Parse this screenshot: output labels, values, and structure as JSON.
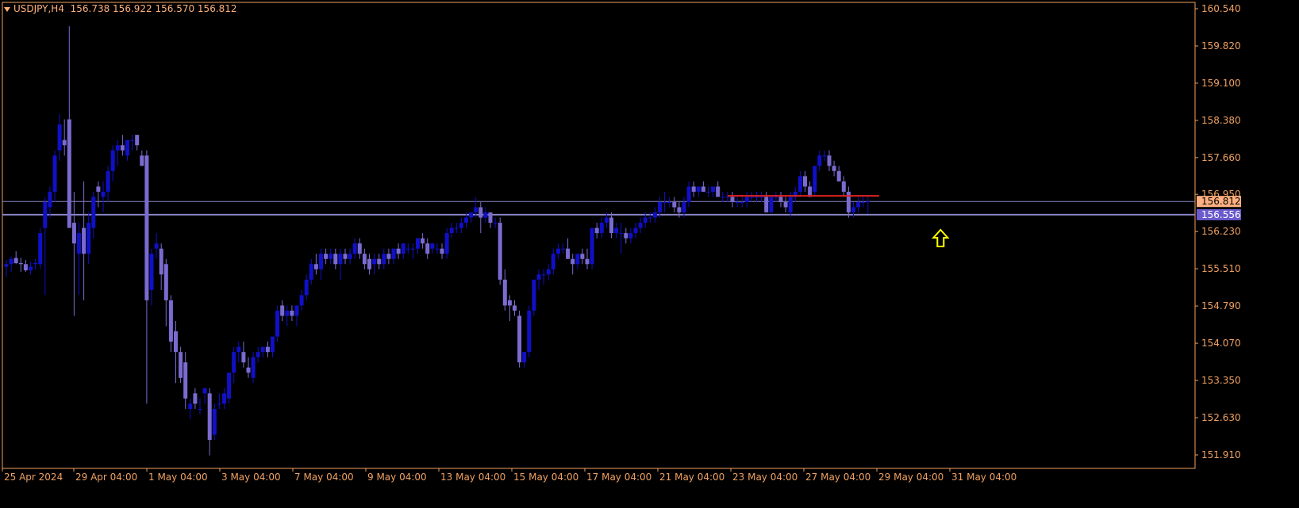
{
  "header": {
    "symbol": "USDJPY,H4",
    "ohlc": "156.738 156.922 156.570 156.812"
  },
  "colors": {
    "background": "#000000",
    "axis": "#f0a060",
    "bull_candle": "#1010c8",
    "bear_candle": "#7a6bd0",
    "price_line": "#8a86c8",
    "resistance_line": "#e02020",
    "arrow": "#ffff00",
    "bid_tag_bg": "#ffb080",
    "support_tag_bg": "#6a5acd"
  },
  "chart_data": {
    "type": "candlestick",
    "timeframe": "H4",
    "symbol": "USDJPY",
    "ylim": [
      151.6,
      160.6
    ],
    "y_ticks": [
      "160.540",
      "159.820",
      "159.100",
      "158.380",
      "157.660",
      "156.950",
      "156.230",
      "155.510",
      "154.790",
      "154.070",
      "153.350",
      "152.630",
      "151.910"
    ],
    "x_ticks": [
      "25 Apr 2024",
      "29 Apr 04:00",
      "1 May 04:00",
      "3 May 04:00",
      "7 May 04:00",
      "9 May 04:00",
      "13 May 04:00",
      "15 May 04:00",
      "17 May 04:00",
      "21 May 04:00",
      "23 May 04:00",
      "27 May 04:00",
      "29 May 04:00",
      "31 May 04:00"
    ],
    "current_price": {
      "value": 156.812,
      "label": "156.812"
    },
    "support_level": {
      "value": 156.556,
      "label": "156.556"
    },
    "resistance_level": {
      "value": 156.92
    },
    "annotation": {
      "type": "up-arrow",
      "candle_index": 193
    },
    "candles": [
      [
        155.55,
        155.68,
        155.35,
        155.6
      ],
      [
        155.6,
        155.75,
        155.45,
        155.7
      ],
      [
        155.72,
        155.85,
        155.6,
        155.62
      ],
      [
        155.62,
        155.72,
        155.45,
        155.6
      ],
      [
        155.6,
        155.68,
        155.45,
        155.48
      ],
      [
        155.48,
        155.65,
        155.4,
        155.55
      ],
      [
        155.6,
        155.7,
        155.5,
        155.62
      ],
      [
        155.6,
        156.3,
        155.5,
        156.2
      ],
      [
        156.3,
        156.9,
        155.0,
        156.8
      ],
      [
        156.7,
        157.1,
        156.5,
        157.0
      ],
      [
        157.0,
        157.8,
        156.8,
        157.7
      ],
      [
        157.8,
        158.5,
        157.6,
        158.3
      ],
      [
        158.0,
        158.4,
        157.7,
        157.9
      ],
      [
        158.4,
        160.2,
        156.3,
        156.3
      ],
      [
        156.4,
        157.0,
        154.6,
        156.0
      ],
      [
        155.8,
        156.4,
        155.0,
        156.2
      ],
      [
        156.3,
        157.2,
        154.9,
        155.8
      ],
      [
        155.8,
        156.6,
        155.6,
        156.4
      ],
      [
        156.3,
        157.0,
        156.1,
        156.9
      ],
      [
        157.1,
        157.2,
        156.7,
        157.0
      ],
      [
        156.9,
        157.2,
        156.6,
        157.0
      ],
      [
        157.0,
        157.5,
        156.8,
        157.4
      ],
      [
        157.4,
        157.9,
        157.2,
        157.8
      ],
      [
        157.8,
        158.0,
        157.5,
        157.9
      ],
      [
        157.9,
        158.1,
        157.7,
        157.8
      ],
      [
        157.7,
        158.0,
        157.6,
        158.0
      ],
      [
        158.0,
        158.1,
        157.8,
        158.0
      ],
      [
        158.1,
        158.1,
        157.8,
        157.9
      ],
      [
        157.7,
        157.8,
        157.5,
        157.5
      ],
      [
        157.7,
        157.8,
        152.9,
        154.9
      ],
      [
        155.1,
        155.9,
        154.8,
        155.8
      ],
      [
        155.9,
        156.2,
        155.7,
        156.0
      ],
      [
        155.9,
        156.0,
        155.1,
        155.4
      ],
      [
        155.6,
        155.7,
        154.4,
        154.9
      ],
      [
        154.9,
        155.0,
        153.9,
        154.1
      ],
      [
        154.3,
        154.5,
        153.3,
        153.9
      ],
      [
        153.9,
        154.0,
        153.3,
        153.4
      ],
      [
        153.7,
        153.9,
        152.8,
        153.0
      ],
      [
        152.8,
        153.0,
        152.6,
        152.9
      ],
      [
        153.1,
        153.2,
        152.8,
        152.9
      ],
      [
        152.8,
        153.0,
        152.7,
        152.8
      ],
      [
        153.1,
        153.2,
        152.9,
        153.2
      ],
      [
        153.1,
        153.2,
        151.9,
        152.2
      ],
      [
        152.3,
        152.9,
        152.2,
        152.8
      ],
      [
        152.9,
        153.1,
        152.8,
        152.9
      ],
      [
        152.9,
        153.2,
        152.8,
        153.1
      ],
      [
        153.0,
        153.5,
        152.9,
        153.5
      ],
      [
        153.5,
        154.0,
        153.3,
        153.9
      ],
      [
        153.9,
        154.1,
        153.7,
        154.0
      ],
      [
        153.9,
        154.1,
        153.6,
        153.7
      ],
      [
        153.6,
        153.8,
        153.4,
        153.5
      ],
      [
        153.4,
        153.9,
        153.3,
        153.8
      ],
      [
        153.8,
        154.0,
        153.7,
        153.9
      ],
      [
        153.9,
        154.0,
        153.8,
        154.0
      ],
      [
        154.0,
        154.1,
        153.8,
        153.9
      ],
      [
        153.9,
        154.2,
        153.8,
        154.2
      ],
      [
        154.2,
        154.8,
        154.1,
        154.7
      ],
      [
        154.8,
        154.9,
        154.5,
        154.6
      ],
      [
        154.6,
        154.8,
        154.4,
        154.7
      ],
      [
        154.7,
        154.8,
        154.5,
        154.6
      ],
      [
        154.6,
        154.8,
        154.4,
        154.8
      ],
      [
        154.8,
        155.1,
        154.7,
        155.0
      ],
      [
        155.0,
        155.4,
        154.9,
        155.3
      ],
      [
        155.3,
        155.7,
        155.2,
        155.6
      ],
      [
        155.6,
        155.8,
        155.4,
        155.5
      ],
      [
        155.5,
        155.9,
        155.3,
        155.8
      ],
      [
        155.8,
        155.9,
        155.6,
        155.7
      ],
      [
        155.7,
        155.9,
        155.6,
        155.8
      ],
      [
        155.8,
        155.9,
        155.5,
        155.6
      ],
      [
        155.6,
        155.9,
        155.3,
        155.8
      ],
      [
        155.8,
        155.9,
        155.6,
        155.7
      ],
      [
        155.7,
        155.9,
        155.6,
        155.8
      ],
      [
        155.8,
        156.1,
        155.7,
        156.0
      ],
      [
        156.0,
        156.1,
        155.7,
        155.8
      ],
      [
        155.8,
        155.9,
        155.5,
        155.6
      ],
      [
        155.7,
        155.8,
        155.4,
        155.5
      ],
      [
        155.6,
        155.8,
        155.4,
        155.7
      ],
      [
        155.7,
        155.8,
        155.5,
        155.6
      ],
      [
        155.6,
        155.9,
        155.5,
        155.8
      ],
      [
        155.8,
        155.9,
        155.6,
        155.7
      ],
      [
        155.7,
        155.9,
        155.6,
        155.9
      ],
      [
        155.9,
        156.0,
        155.7,
        155.8
      ],
      [
        155.8,
        156.0,
        155.7,
        156.0
      ],
      [
        155.9,
        156.0,
        155.8,
        155.9
      ],
      [
        155.9,
        156.0,
        155.7,
        155.9
      ],
      [
        155.9,
        156.1,
        155.8,
        156.1
      ],
      [
        156.1,
        156.2,
        155.9,
        156.0
      ],
      [
        156.0,
        156.1,
        155.7,
        155.8
      ],
      [
        155.9,
        156.0,
        155.8,
        156.0
      ],
      [
        155.9,
        156.0,
        155.8,
        155.9
      ],
      [
        155.9,
        156.0,
        155.7,
        155.8
      ],
      [
        155.8,
        156.3,
        155.7,
        156.2
      ],
      [
        156.2,
        156.4,
        156.1,
        156.3
      ],
      [
        156.3,
        156.4,
        156.2,
        156.3
      ],
      [
        156.3,
        156.5,
        156.2,
        156.4
      ],
      [
        156.4,
        156.6,
        156.3,
        156.5
      ],
      [
        156.5,
        156.6,
        156.4,
        156.6
      ],
      [
        156.6,
        156.9,
        156.5,
        156.7
      ],
      [
        156.7,
        156.8,
        156.2,
        156.5
      ],
      [
        156.5,
        156.7,
        156.4,
        156.6
      ],
      [
        156.6,
        156.6,
        156.3,
        156.4
      ],
      [
        156.4,
        156.5,
        156.3,
        156.4
      ],
      [
        156.4,
        156.5,
        155.2,
        155.3
      ],
      [
        155.3,
        155.5,
        154.7,
        154.8
      ],
      [
        154.9,
        155.0,
        154.5,
        154.8
      ],
      [
        154.8,
        154.9,
        154.6,
        154.7
      ],
      [
        154.6,
        154.7,
        153.6,
        153.7
      ],
      [
        153.7,
        153.9,
        153.6,
        153.9
      ],
      [
        153.9,
        154.8,
        153.8,
        154.7
      ],
      [
        154.7,
        155.3,
        154.6,
        155.3
      ],
      [
        155.3,
        155.5,
        155.1,
        155.4
      ],
      [
        155.4,
        155.5,
        155.2,
        155.4
      ],
      [
        155.4,
        155.6,
        155.3,
        155.5
      ],
      [
        155.5,
        155.9,
        155.4,
        155.8
      ],
      [
        155.8,
        156.0,
        155.7,
        155.9
      ],
      [
        155.9,
        156.0,
        155.8,
        155.9
      ],
      [
        155.9,
        156.1,
        155.7,
        155.7
      ],
      [
        155.7,
        155.8,
        155.4,
        155.6
      ],
      [
        155.6,
        155.8,
        155.5,
        155.8
      ],
      [
        155.8,
        155.9,
        155.6,
        155.7
      ],
      [
        155.7,
        155.9,
        155.5,
        155.6
      ],
      [
        155.6,
        156.3,
        155.5,
        156.3
      ],
      [
        156.3,
        156.4,
        156.1,
        156.2
      ],
      [
        156.2,
        156.5,
        156.1,
        156.4
      ],
      [
        156.4,
        156.6,
        156.3,
        156.5
      ],
      [
        156.5,
        156.6,
        156.1,
        156.2
      ],
      [
        156.2,
        156.4,
        156.1,
        156.3
      ],
      [
        156.2,
        156.4,
        155.8,
        156.2
      ],
      [
        156.2,
        156.3,
        156.0,
        156.1
      ],
      [
        156.1,
        156.3,
        156.0,
        156.2
      ],
      [
        156.2,
        156.4,
        156.1,
        156.3
      ],
      [
        156.3,
        156.5,
        156.2,
        156.4
      ],
      [
        156.4,
        156.6,
        156.3,
        156.5
      ],
      [
        156.5,
        156.6,
        156.4,
        156.5
      ],
      [
        156.5,
        156.7,
        156.4,
        156.6
      ],
      [
        156.6,
        156.9,
        156.5,
        156.8
      ],
      [
        156.8,
        157.0,
        156.6,
        156.8
      ],
      [
        156.8,
        156.9,
        156.7,
        156.8
      ],
      [
        156.8,
        156.9,
        156.6,
        156.7
      ],
      [
        156.7,
        156.8,
        156.5,
        156.6
      ],
      [
        156.6,
        156.9,
        156.5,
        156.8
      ],
      [
        156.8,
        157.2,
        156.7,
        157.1
      ],
      [
        157.1,
        157.2,
        156.9,
        157.0
      ],
      [
        157.0,
        157.1,
        156.9,
        157.1
      ],
      [
        157.1,
        157.2,
        157.0,
        157.0
      ],
      [
        157.0,
        157.1,
        156.9,
        157.0
      ],
      [
        157.0,
        157.1,
        156.9,
        157.1
      ],
      [
        157.1,
        157.2,
        156.9,
        156.9
      ],
      [
        156.9,
        157.0,
        156.8,
        156.9
      ],
      [
        156.9,
        157.0,
        156.8,
        156.9
      ],
      [
        156.9,
        157.0,
        156.7,
        156.8
      ],
      [
        156.8,
        156.9,
        156.7,
        156.8
      ],
      [
        156.8,
        156.9,
        156.7,
        156.8
      ],
      [
        156.8,
        157.0,
        156.7,
        156.9
      ],
      [
        156.9,
        157.0,
        156.8,
        156.9
      ],
      [
        156.9,
        157.0,
        156.8,
        156.9
      ],
      [
        156.9,
        157.0,
        156.8,
        156.9
      ],
      [
        156.9,
        157.0,
        156.6,
        156.6
      ],
      [
        156.6,
        156.9,
        156.6,
        156.9
      ],
      [
        156.9,
        157.0,
        156.8,
        156.9
      ],
      [
        156.9,
        157.0,
        156.7,
        156.8
      ],
      [
        156.8,
        156.9,
        156.6,
        156.7
      ],
      [
        156.6,
        157.0,
        156.5,
        156.9
      ],
      [
        156.9,
        157.1,
        156.8,
        157.0
      ],
      [
        157.0,
        157.4,
        156.9,
        157.3
      ],
      [
        157.3,
        157.4,
        157.0,
        157.1
      ],
      [
        157.1,
        157.2,
        156.9,
        156.9
      ],
      [
        157.0,
        157.5,
        156.9,
        157.5
      ],
      [
        157.5,
        157.8,
        157.4,
        157.7
      ],
      [
        157.7,
        157.8,
        157.6,
        157.7
      ],
      [
        157.7,
        157.8,
        157.4,
        157.5
      ],
      [
        157.5,
        157.6,
        157.3,
        157.4
      ],
      [
        157.4,
        157.5,
        157.2,
        157.2
      ],
      [
        157.2,
        157.3,
        156.9,
        157.0
      ],
      [
        157.0,
        157.1,
        156.5,
        156.6
      ],
      [
        156.6,
        156.8,
        156.5,
        156.7
      ],
      [
        156.7,
        156.9,
        156.6,
        156.8
      ],
      [
        156.8,
        156.9,
        156.7,
        156.8
      ],
      [
        156.8,
        156.92,
        156.57,
        156.812
      ]
    ]
  }
}
